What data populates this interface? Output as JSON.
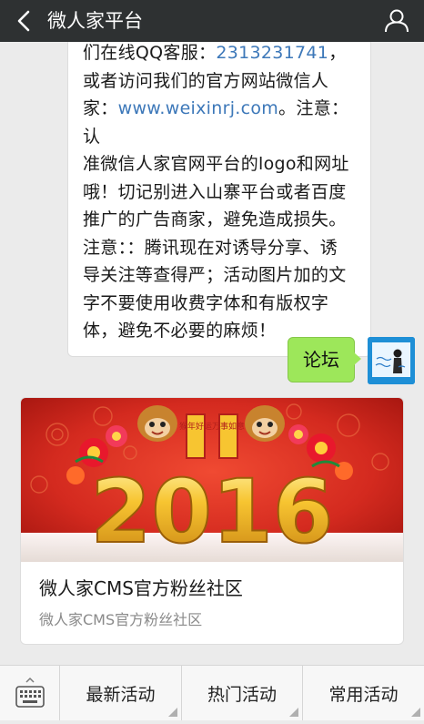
{
  "header": {
    "title": "微人家平台",
    "back_icon": "back-arrow-icon",
    "profile_icon": "person-icon"
  },
  "messages": {
    "incoming": {
      "lines": [
        {
          "text": "们在线QQ客服：",
          "link": "2313231741",
          "tail": "，"
        },
        {
          "text": "或者访问我们的官方网站微信人"
        },
        {
          "text": "家：",
          "link": "www.weixinrj.com",
          "tail": "。注意：认"
        },
        {
          "text": "准微信人家官网平台的logo和网址"
        },
        {
          "text": "哦！切记别进入山寨平台或者百度"
        },
        {
          "text": "推广的广告商家，避免造成损失。"
        },
        {
          "text": "注意：：腾讯现在对诱导分享、诱"
        },
        {
          "text": "导关注等查得严；活动图片加的文"
        },
        {
          "text": "字不要使用收费字体和有版权字"
        },
        {
          "text": "体，避免不必要的麻烦！"
        }
      ]
    },
    "outgoing": {
      "text": "论坛"
    }
  },
  "card": {
    "title": "微人家CMS官方粉丝社区",
    "description": "微人家CMS官方粉丝社区",
    "image": {
      "year_text": "2016",
      "banner_left": "猴年好运",
      "banner_right": "万事如意"
    }
  },
  "bottom_menu": {
    "keyboard_icon": "keyboard-icon",
    "items": [
      {
        "label": "最新活动"
      },
      {
        "label": "热门活动"
      },
      {
        "label": "常用活动"
      }
    ]
  },
  "colors": {
    "header_bg": "#2e3132",
    "chat_bg": "#ebebeb",
    "link": "#3d78b9",
    "outgoing_bubble": "#9de75a",
    "card_image_bg": "#d42a1f"
  }
}
